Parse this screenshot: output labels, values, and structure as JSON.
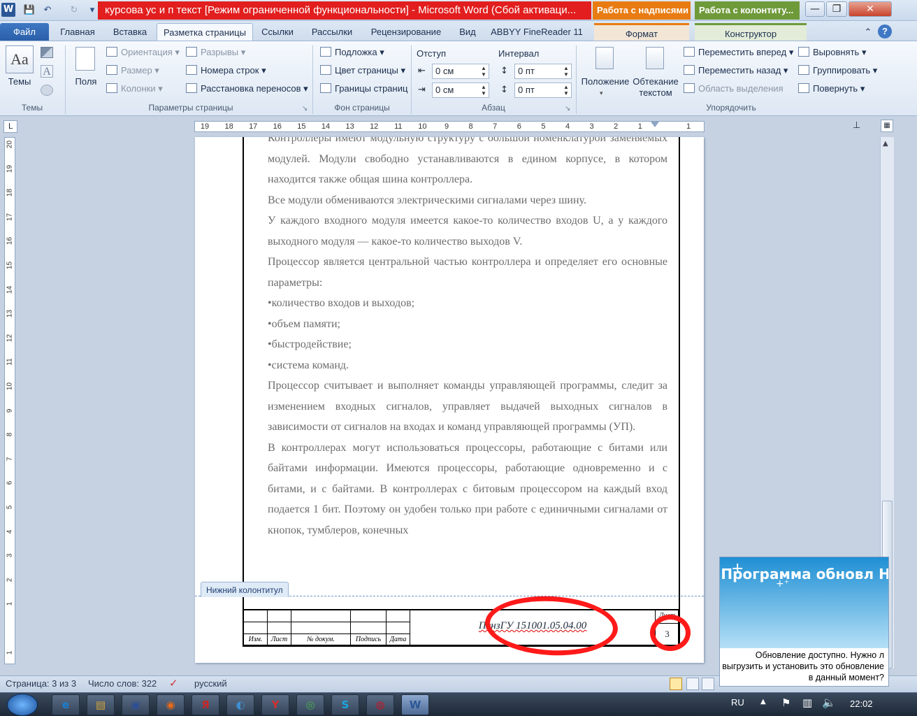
{
  "window": {
    "title": "курсова ус и п текст [Режим ограниченной функциональности] - Microsoft Word (Сбой активаци...",
    "context_tab_1": "Работа с надписями",
    "context_tab_2": "Работа с колонтиту...",
    "context_tab_1_color": "#e87c12",
    "context_tab_2_color": "#6f9a3a",
    "minimize": "—",
    "maximize": "❐",
    "close": "✕"
  },
  "qat": {
    "word_icon": "W",
    "save_icon": "💾",
    "undo_icon": "↶",
    "redo_icon": "↻",
    "customize_icon": "▾"
  },
  "tabs": {
    "file": "Файл",
    "home": "Главная",
    "insert": "Вставка",
    "page_layout": "Разметка страницы",
    "references": "Ссылки",
    "mailings": "Рассылки",
    "review": "Рецензирование",
    "view": "Вид",
    "abbyy": "ABBYY FineReader 11",
    "format": "Формат",
    "designer": "Конструктор"
  },
  "ribbon": {
    "themes": {
      "button": "Темы",
      "group": "Темы"
    },
    "page_setup": {
      "group": "Параметры страницы",
      "margins": "Поля",
      "orientation": "Ориентация",
      "size": "Размер",
      "columns": "Колонки",
      "breaks": "Разрывы",
      "line_numbers": "Номера строк",
      "hyphenation": "Расстановка переносов"
    },
    "page_background": {
      "group": "Фон страницы",
      "watermark": "Подложка",
      "page_color": "Цвет страницы",
      "page_borders": "Границы страниц"
    },
    "paragraph": {
      "group": "Абзац",
      "indent_label": "Отступ",
      "indent_left": "0 см",
      "indent_right": "0 см",
      "spacing_label": "Интервал",
      "spacing_before": "0 пт",
      "spacing_after": "0 пт"
    },
    "arrange": {
      "group": "Упорядочить",
      "position": "Положение",
      "wrap_text": "Обтекание текстом",
      "bring_forward": "Переместить вперед",
      "send_backward": "Переместить назад",
      "selection_pane": "Область выделения",
      "align": "Выровнять",
      "group_btn": "Группировать",
      "rotate": "Повернуть"
    }
  },
  "ruler": {
    "horizontal_ticks": [
      "19",
      "18",
      "17",
      "16",
      "15",
      "14",
      "13",
      "12",
      "11",
      "10",
      "9",
      "8",
      "7",
      "6",
      "5",
      "4",
      "3",
      "2",
      "1",
      "",
      "1"
    ],
    "vertical_ticks": [
      "20",
      "19",
      "18",
      "17",
      "16",
      "15",
      "14",
      "13",
      "12",
      "11",
      "10",
      "9",
      "8",
      "7",
      "6",
      "5",
      "4",
      "3",
      "2",
      "1",
      "",
      "1"
    ]
  },
  "document": {
    "paragraphs": [
      "Контроллеры имеют модульную структуру с большой номенклатурой заменяемых модулей. Модули свободно устанавливаются в едином корпусе, в котором находится также общая шина контроллера.",
      "Все модули обмениваются электрическими сигналами через шину.",
      "У каждого входного модуля имеется какое-то количество входов U, а у каждого выходного модуля — какое-то количество выходов V.",
      "Процессор является центральной частью контроллера и определяет его основные параметры:",
      "•количество входов и выходов;",
      "•объем памяти;",
      "•быстродействие;",
      "•система команд.",
      "Процессор считывает и выполняет команды управляющей программы, следит за изменением входных сигналов, управляет выдачей выходных сигналов в зависимости от сигналов на входах и команд управляющей программы (УП).",
      "В контроллерах могут использоваться процессоры, работающие с битами или байтами информации. Имеются процессоры, работающие одновременно и с битами, и с байтами. В контроллерах с битовым процессором на каждый вход подается 1 бит. Поэтому он удобен только при работе с единичными сигналами от кнопок, тумблеров, конечных"
    ],
    "footer_tag": "Нижний колонтитул",
    "stamp": {
      "code": "ПензГУ 151001.05.04.00",
      "sheet_label": "Лист",
      "sheet_number": "3",
      "col_izm": "Изм.",
      "col_list": "Лист",
      "col_doc": "№ докум.",
      "col_sign": "Подпись",
      "col_date": "Дата"
    }
  },
  "statusbar": {
    "page": "Страница: 3 из 3",
    "words": "Число слов: 322",
    "language": "русский"
  },
  "hp_popup": {
    "title": "Программа обновл HP",
    "message": "Обновление доступно. Нужно л выгрузить и установить это обновление в данный момент?"
  },
  "taskbar": {
    "apps": [
      "IE",
      "Explorer",
      "Save",
      "Firefox",
      "Yandex",
      "Media",
      "Yandex Browser",
      "Chrome",
      "Skype",
      "Opera",
      "Word"
    ],
    "lang": "RU",
    "clock": "22:02"
  }
}
